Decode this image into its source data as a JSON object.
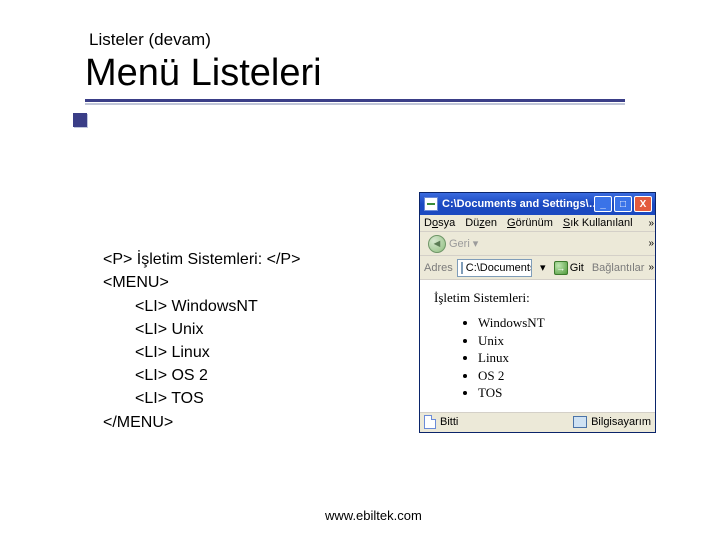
{
  "heading": {
    "sub": "Listeler (devam)",
    "main": "Menü Listeleri"
  },
  "code": {
    "l1": "<P> İşletim Sistemleri: </P>",
    "l2": "<MENU>",
    "l3": "<LI> WindowsNT",
    "l4": "<LI> Unix",
    "l5": "<LI> Linux",
    "l6": "<LI> OS 2",
    "l7": "<LI> TOS",
    "l8": "</MENU>"
  },
  "browser": {
    "title": "C:\\Documents and Settings\\…",
    "menus": {
      "file_pre": "D",
      "file_u": "o",
      "file_post": "sya",
      "edit_pre": "Dü",
      "edit_u": "z",
      "edit_post": "en",
      "view_pre": "",
      "view_u": "G",
      "view_post": "örünüm",
      "fav_pre": "",
      "fav_u": "S",
      "fav_post": "ık Kullanılanl"
    },
    "nav": {
      "back": "Geri"
    },
    "address": {
      "label": "Adres",
      "value": "C:\\Documents",
      "go": "Git",
      "links": "Bağlantılar"
    },
    "content": {
      "heading": "İşletim Sistemleri:",
      "items": [
        "WindowsNT",
        "Unix",
        "Linux",
        "OS 2",
        "TOS"
      ]
    },
    "status": {
      "done": "Bitti",
      "zone": "Bilgisayarım"
    },
    "chevrons": "»"
  },
  "footer": "www.ebiltek.com"
}
